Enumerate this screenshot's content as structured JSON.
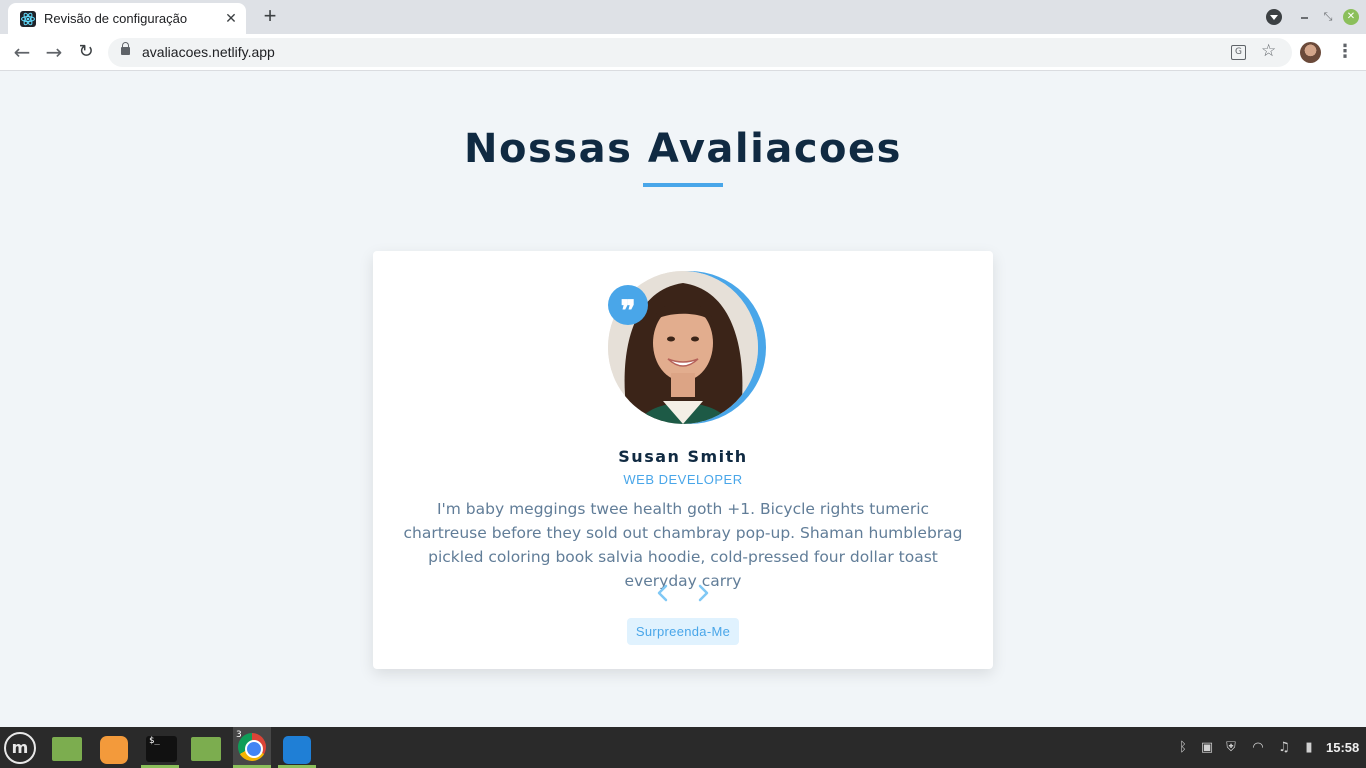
{
  "browser": {
    "tab_title": "Revisão de configuração",
    "tab_close": "✕",
    "new_tab": "+",
    "url": "avaliacoes.netlify.app"
  },
  "page": {
    "heading": "Nossas Avaliacoes",
    "accent_color": "#49a6e9",
    "heading_color": "#102a42",
    "review": {
      "author": "Susan Smith",
      "job": "WEB DEVELOPER",
      "text": "I'm baby meggings twee health goth +1. Bicycle rights tumeric chartreuse before they sold out chambray pop-up. Shaman humblebrag pickled coloring book salvia hoodie, cold-pressed four dollar toast everyday carry",
      "quote_glyph": "❞",
      "random_button": "Surpreenda-Me"
    }
  },
  "taskbar": {
    "menu_glyph": "m",
    "chrome_window_count": "3",
    "clock": "15:58"
  }
}
